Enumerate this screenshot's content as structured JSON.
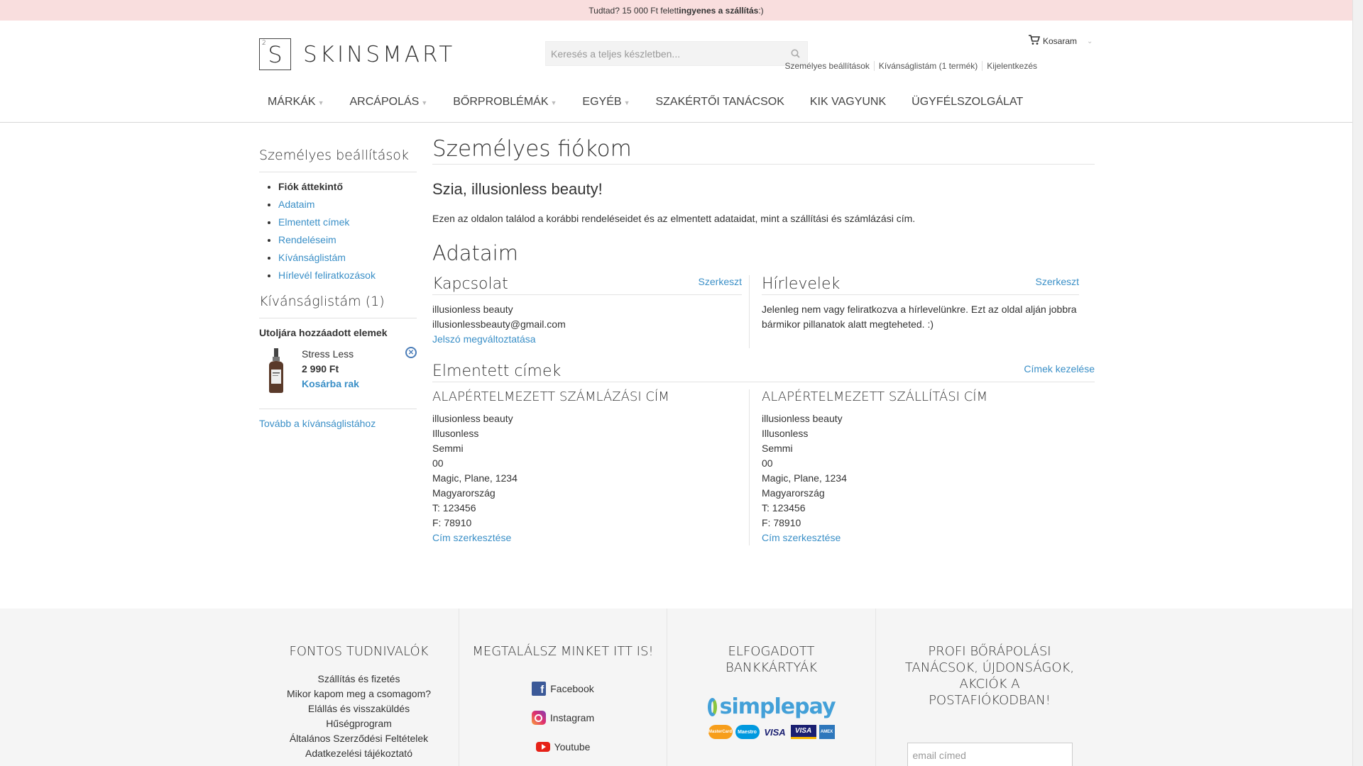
{
  "topbar": {
    "pre": "Tudtad? 15 000 Ft felett ",
    "bold": "ingyenes a szállítás",
    "post": " :)"
  },
  "logo": {
    "letter": "S",
    "sup": "2",
    "text": "SKINSMART"
  },
  "search": {
    "placeholder": "Keresés a teljes készletben..."
  },
  "cart": {
    "label": "Kosaram"
  },
  "account_links": [
    "Személyes beállítások",
    "Kívánságlistám (1 termék)",
    "Kijelentkezés"
  ],
  "nav": [
    {
      "label": "MÁRKÁK",
      "dropdown": true
    },
    {
      "label": "ARCÁPOLÁS",
      "dropdown": true
    },
    {
      "label": "BŐRPROBLÉMÁK",
      "dropdown": true
    },
    {
      "label": "EGYÉB",
      "dropdown": true
    },
    {
      "label": "SZAKÉRTŐI TANÁCSOK",
      "dropdown": false
    },
    {
      "label": "KIK VAGYUNK",
      "dropdown": false
    },
    {
      "label": "ÜGYFÉLSZOLGÁLAT",
      "dropdown": false
    }
  ],
  "sidebar": {
    "title": "Személyes beállítások",
    "items": [
      "Fiók áttekintő",
      "Adataim",
      "Elmentett címek",
      "Rendeléseim",
      "Kívánságlistám",
      "Hírlevél feliratkozások"
    ],
    "wishlist_title": "Kívánságlistám (1)",
    "recent_label": "Utoljára hozzáadott elemek",
    "wish_item": {
      "name": "Stress Less",
      "price": "2 990 Ft",
      "add_to_cart": "Kosárba rak"
    },
    "more_link": "Tovább a kívánságlistához"
  },
  "main": {
    "title": "Személyes fiókom",
    "greeting": "Szia, illusionless beauty!",
    "intro": "Ezen az oldalon találod a korábbi rendeléseidet és az elmentett adataidat, mint a szállítási és számlázási cím.",
    "section_title": "Adataim",
    "contact": {
      "title": "Kapcsolat",
      "edit": "Szerkeszt",
      "name": "illusionless beauty",
      "email": "illusionlessbeauty@gmail.com",
      "change_password": "Jelszó megváltoztatása"
    },
    "newsletter": {
      "title": "Hírlevelek",
      "edit": "Szerkeszt",
      "text": "Jelenleg nem vagy feliratkozva a hírlevelünkre. Ezt az oldal alján jobbra bármikor pillanatok alatt megteheted. :)"
    },
    "addresses": {
      "title": "Elmentett címek",
      "manage": "Címek kezelése",
      "billing": {
        "title": "ALAPÉRTELMEZETT SZÁMLÁZÁSI CÍM",
        "lines": [
          "illusionless beauty",
          "Illusonless",
          "Semmi",
          "00",
          "Magic, Plane, 1234",
          "Magyarország",
          "T: 123456",
          "F: 78910"
        ],
        "edit": "Cím szerkesztése"
      },
      "shipping": {
        "title": "ALAPÉRTELMEZETT SZÁLLÍTÁSI CÍM",
        "lines": [
          "illusionless beauty",
          "Illusonless",
          "Semmi",
          "00",
          "Magic, Plane, 1234",
          "Magyarország",
          "T: 123456",
          "F: 78910"
        ],
        "edit": "Cím szerkesztése"
      }
    }
  },
  "footer": {
    "col1": {
      "title": "FONTOS TUDNIVALÓK",
      "links": [
        "Szállítás és fizetés",
        "Mikor kapom meg a csomagom?",
        "Elállás és visszaküldés",
        "Hűségprogram",
        "Általános Szerződési Feltételek",
        "Adatkezelési tájékoztató"
      ]
    },
    "col2": {
      "title": "MEGTALÁLSZ MINKET ITT IS!",
      "links": [
        "Facebook",
        "Instagram",
        "Youtube"
      ]
    },
    "col3": {
      "title_line1": "ELFOGADOTT",
      "title_line2": "BANKKÁRTYÁK",
      "brand": "simplepay",
      "cards": [
        "MasterCard",
        "Maestro",
        "VISA",
        "VISA",
        "AMEX"
      ]
    },
    "col4": {
      "title_lines": [
        "PROFI BŐRÁPOLÁSI",
        "TANÁCSOK, ÚJDONSÁGOK,",
        "AKCIÓK A",
        "POSTAFIÓKODBAN!"
      ],
      "email_placeholder": "email címed"
    }
  },
  "colors": {
    "link": "#3a8fc7",
    "topbar_bg": "#f9dede",
    "footer_bg": "#f5f5f5"
  }
}
